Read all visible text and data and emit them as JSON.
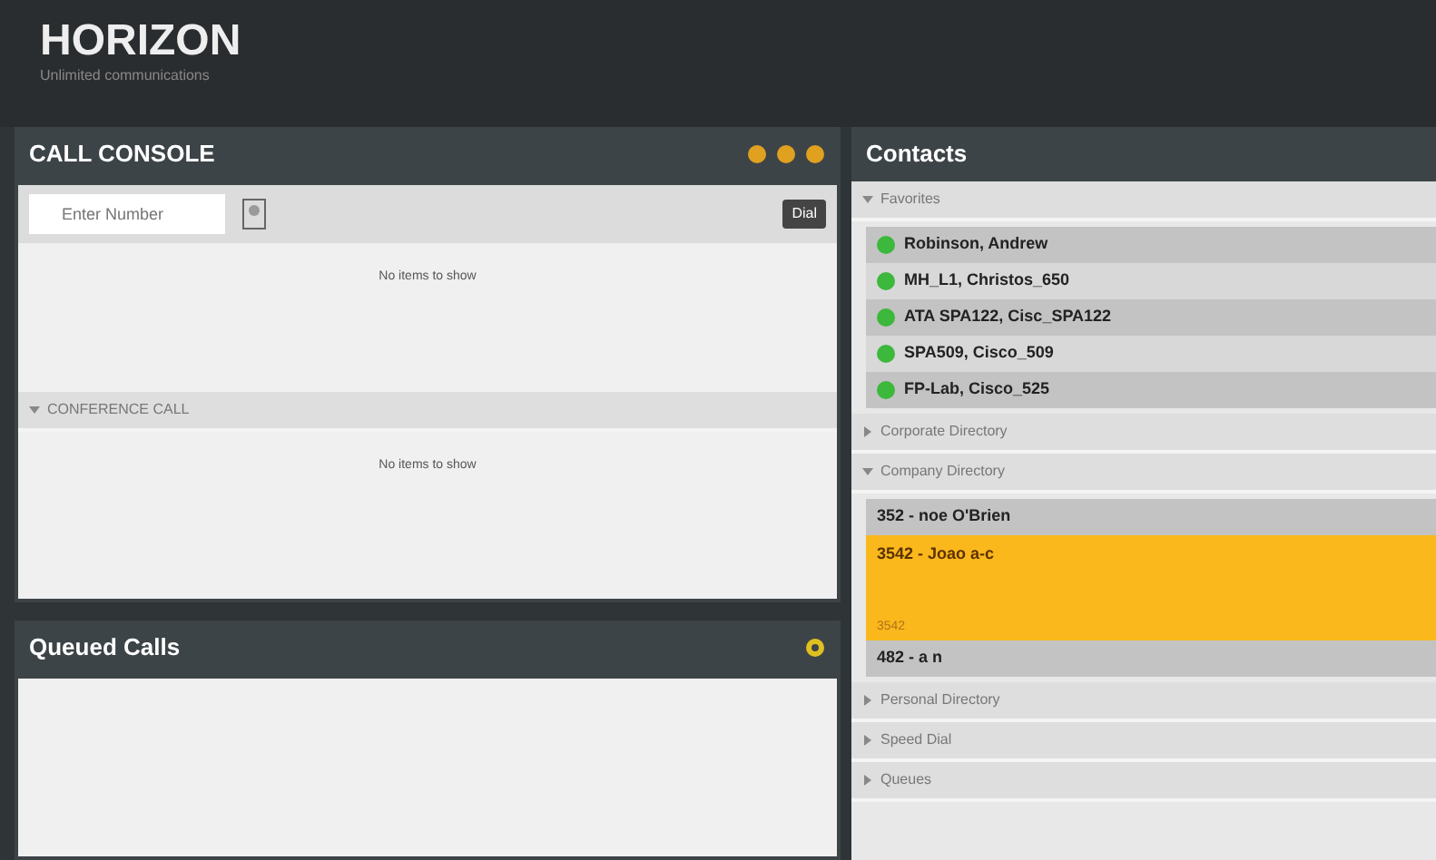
{
  "brand": {
    "name": "HORIZON",
    "tagline": "Unlimited communications"
  },
  "call_console": {
    "title": "CALL CONSOLE",
    "number_field": {
      "placeholder": "Enter Number"
    },
    "dial_button": "Dial",
    "empty_text": "No items to show",
    "conference": {
      "title": "CONFERENCE CALL",
      "expanded": true,
      "empty_text": "No items to show"
    }
  },
  "queued_calls": {
    "title": "Queued Calls"
  },
  "contacts": {
    "title": "Contacts",
    "sections": [
      {
        "title": "Favorites",
        "expanded": true,
        "items": [
          {
            "name": "Robinson, Andrew",
            "online": true
          },
          {
            "name": "MH_L1, Christos_650",
            "online": true
          },
          {
            "name": "ATA SPA122, Cisc_SPA122",
            "online": true
          },
          {
            "name": "SPA509, Cisco_509",
            "online": true
          },
          {
            "name": "FP-Lab, Cisco_525",
            "online": true
          }
        ]
      },
      {
        "title": "Corporate Directory",
        "expanded": false
      },
      {
        "title": "Company Directory",
        "expanded": true,
        "items": [
          {
            "name": "352 - noe O'Brien",
            "selected": false
          },
          {
            "name": "3542 - Joao a-c",
            "selected": true,
            "detail": "3542"
          },
          {
            "name": "482 - a n",
            "selected": false
          }
        ]
      },
      {
        "title": "Personal Directory",
        "expanded": false
      },
      {
        "title": "Speed Dial",
        "expanded": false
      },
      {
        "title": "Queues",
        "expanded": false
      }
    ]
  }
}
